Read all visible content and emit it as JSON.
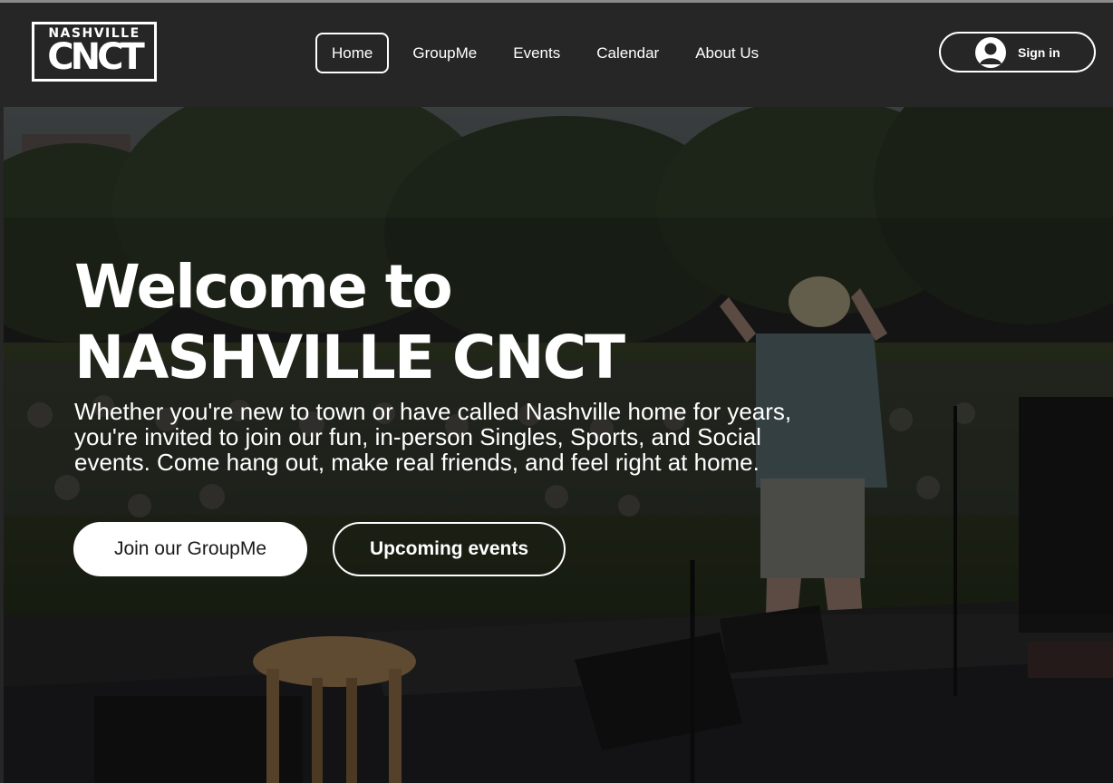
{
  "header": {
    "logo": {
      "top_text": "NASHVILLE",
      "bottom_text": "CNCT"
    },
    "nav": [
      {
        "label": "Home",
        "active": true
      },
      {
        "label": "GroupMe",
        "active": false
      },
      {
        "label": "Events",
        "active": false
      },
      {
        "label": "Calendar",
        "active": false
      },
      {
        "label": "About Us",
        "active": false
      }
    ],
    "signin": {
      "label": "Sign in",
      "icon": "user-avatar-icon"
    }
  },
  "hero": {
    "title_line1": "Welcome to",
    "title_line2": "NASHVILLE CNCT",
    "description": "Whether you're new to town or have called Nashville home for years, you're invited to join our fun, in-person Singles, Sports, and Social events. Come hang out, make real friends, and feel right at home.",
    "primary_button": "Join our GroupMe",
    "secondary_button": "Upcoming events"
  },
  "colors": {
    "header_bg": "#262626",
    "text": "#ffffff",
    "primary_button_bg": "#ffffff"
  }
}
